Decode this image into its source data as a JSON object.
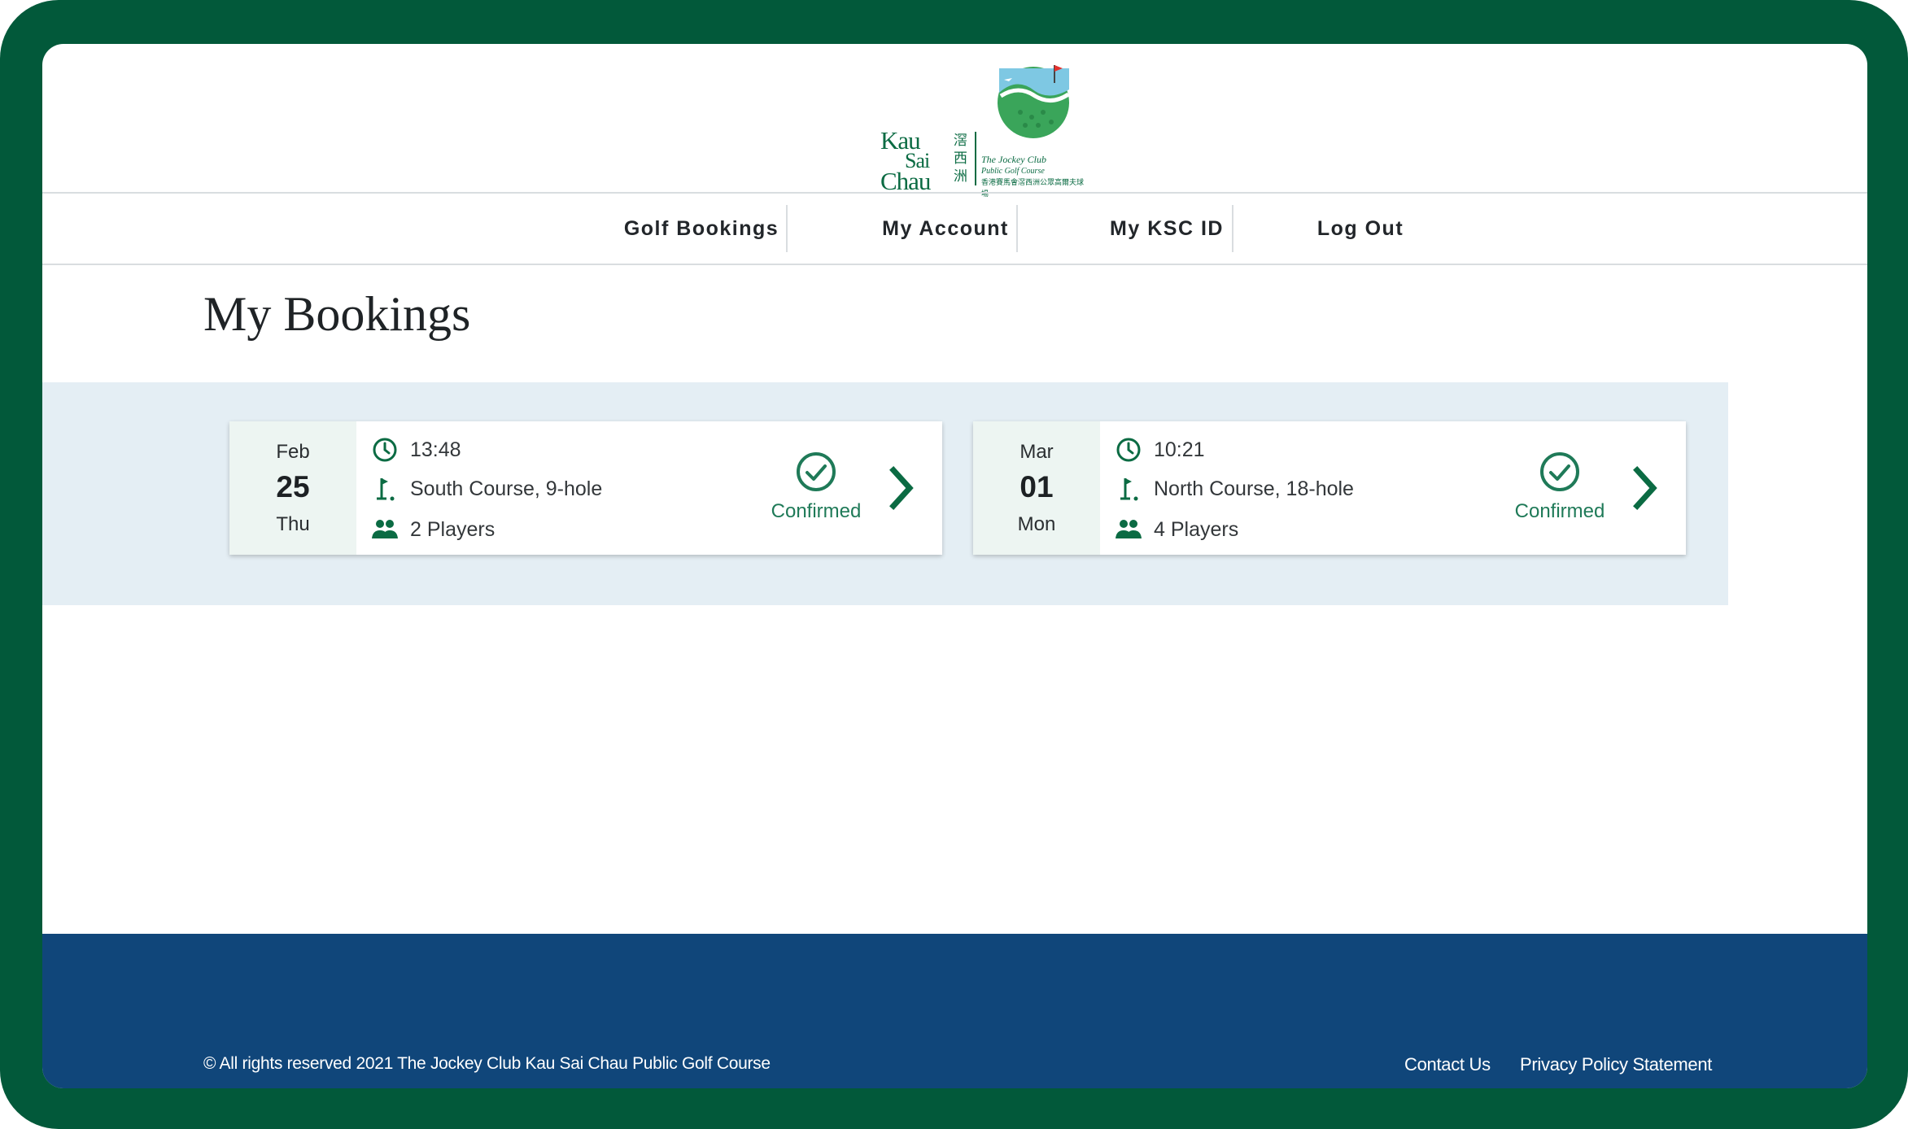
{
  "logo": {
    "text_en": [
      "Kau",
      "Sai",
      "Chau"
    ],
    "text_cn": [
      "滘",
      "西",
      "洲"
    ],
    "subtitle": [
      "The Jockey Club",
      "Public Golf Course",
      "香港賽馬會滘西洲公眾高爾夫球場"
    ]
  },
  "nav": {
    "items": [
      {
        "label": "Golf Bookings"
      },
      {
        "label": "My Account"
      },
      {
        "label": "My KSC ID"
      },
      {
        "label": "Log Out"
      }
    ]
  },
  "page": {
    "title": "My Bookings"
  },
  "bookings": [
    {
      "month": "Feb",
      "day": "25",
      "weekday": "Thu",
      "time": "13:48",
      "course": "South Course, 9-hole",
      "players": "2 Players",
      "status": "Confirmed"
    },
    {
      "month": "Mar",
      "day": "01",
      "weekday": "Mon",
      "time": "10:21",
      "course": "North Course, 18-hole",
      "players": "4 Players",
      "status": "Confirmed"
    }
  ],
  "footer": {
    "copyright": "© All rights reserved 2021   The Jockey Club Kau Sai Chau Public Golf Course",
    "links": [
      "Contact Us",
      "Privacy Policy Statement"
    ]
  },
  "colors": {
    "frame": "#02593a",
    "brand_green": "#0b6b43",
    "footer_blue": "#10467a",
    "band": "#e4eef4",
    "date_bg": "#edf5f2"
  },
  "icons": {
    "time": "clock-icon",
    "course": "golf-flag-icon",
    "players": "people-icon",
    "status": "check-circle-icon",
    "open": "chevron-right-icon"
  }
}
